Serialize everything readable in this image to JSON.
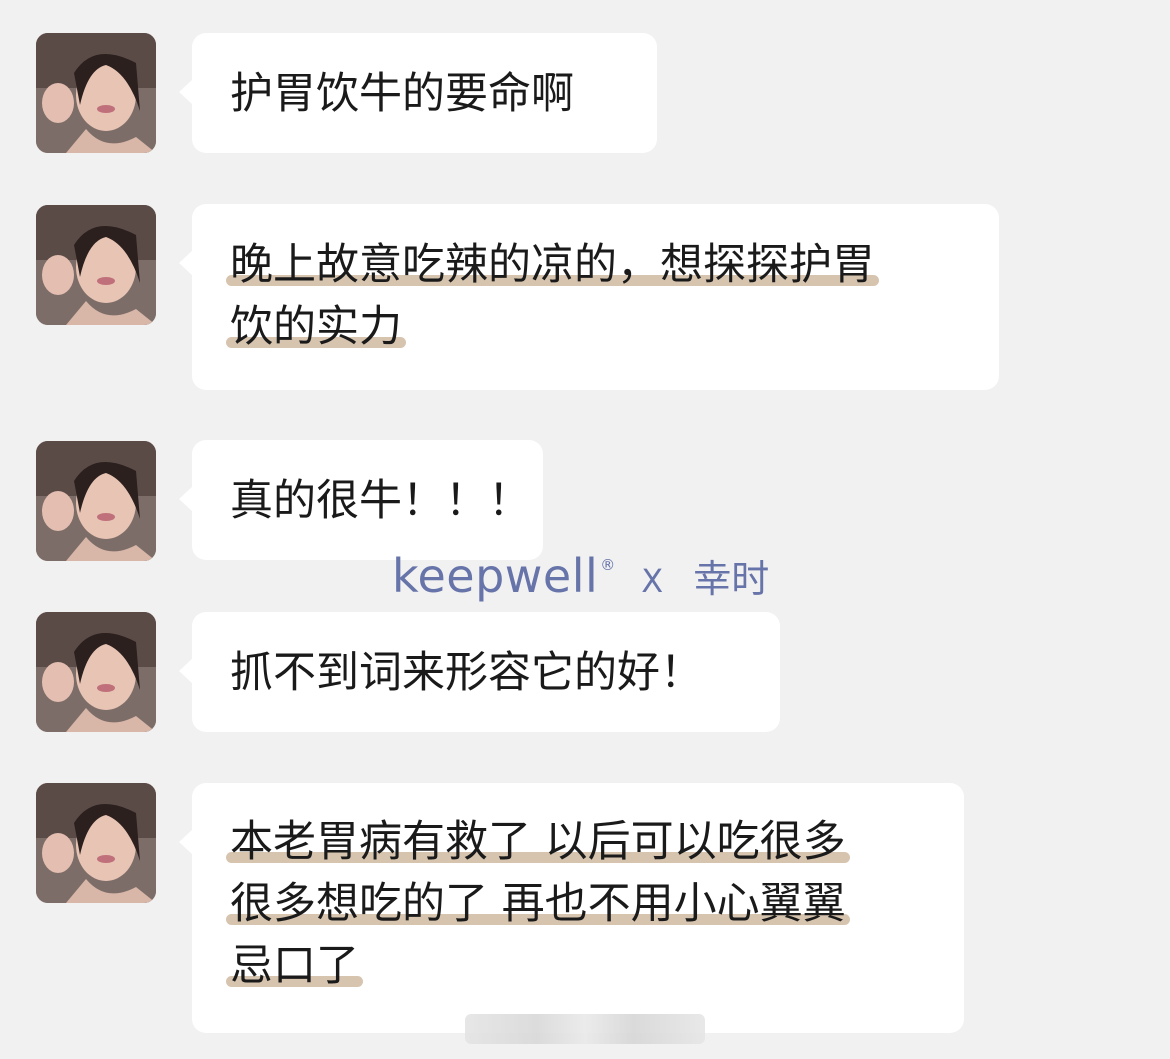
{
  "messages": [
    {
      "lines": [
        {
          "text": "护胃饮牛的要命啊",
          "highlight": false
        }
      ]
    },
    {
      "lines": [
        {
          "text": "晚上故意吃辣的凉的，想探探护胃",
          "highlight": true
        },
        {
          "text": "饮的实力",
          "highlight": true
        }
      ]
    },
    {
      "lines": [
        {
          "text": "真的很牛！！！",
          "highlight": false
        }
      ]
    },
    {
      "lines": [
        {
          "text": "抓不到词来形容它的好！",
          "highlight": false
        }
      ]
    },
    {
      "lines": [
        {
          "text": "本老胃病有救了 以后可以吃很多",
          "highlight": true
        },
        {
          "text": "很多想吃的了 再也不用小心翼翼",
          "highlight": true
        },
        {
          "text": "忌口了",
          "highlight": true
        }
      ]
    }
  ],
  "watermark": {
    "brand": "keepwell",
    "registered": "®",
    "separator": "X",
    "partner": "幸时"
  },
  "colors": {
    "background": "#f1f1f1",
    "bubble": "#ffffff",
    "highlight": "#bda07e",
    "watermark": "#5c6aa3"
  },
  "icons": {
    "avatar": "user-avatar-photo"
  }
}
